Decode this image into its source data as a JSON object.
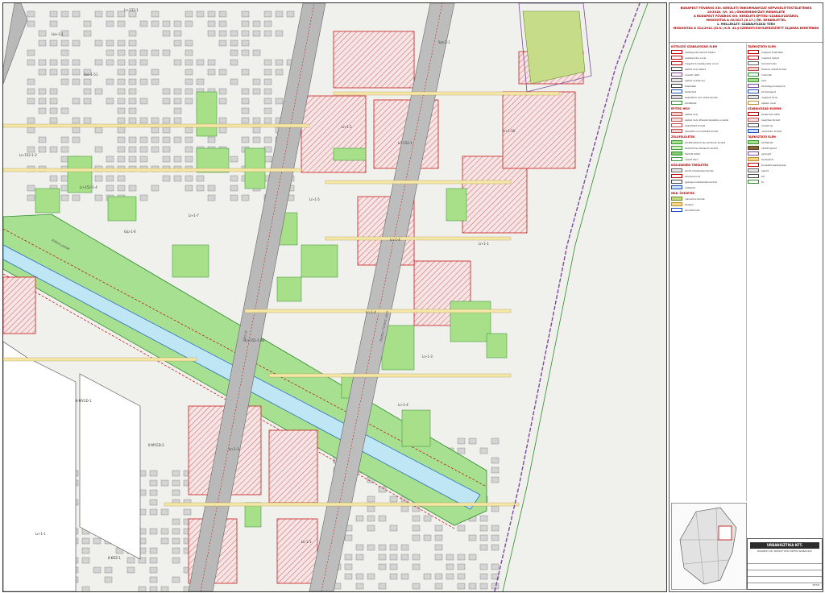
{
  "legend": {
    "titles": [
      "BUDAPEST FŐVÁROS XIII. KERÜLETI ÖNKORMÁNYZAT KÉPVISELŐ-TESTÜLETÉNEK",
      "16/2018. (VI. 15.) ÖNKORMÁNYZATI RENDELETE",
      "A BUDAPEST FŐVÁROS XIII. KERÜLETI ÉPÍTÉSI SZABÁLYZATÁRÓL",
      "MÓDOSÍTVA A 20/2017.(X.17.) ÖR. RENDELETTEL",
      "1. MELLÉKLET: SZABÁLYOZÁSI TERV",
      "MÓDOSÍTÁS A 314/2012.(XI.8.) K.R. 41.§ SZERINTI EGYSZERŰSÍTETT ELJÁRÁS KERETÉBEN"
    ],
    "left_sections": [
      {
        "head": "KÖTELEZŐ SZABÁLYOZÁSI ELEM",
        "rows": [
          {
            "color": "#ffffff",
            "border": "#c00000",
            "text": "szabályozási terület határa"
          },
          {
            "color": "#ffffff",
            "border": "#c00000",
            "text": "szabályozási vonal"
          },
          {
            "color": "#ffffff",
            "border": "#c00000",
            "text": "megszűnő szabályozási vonal"
          },
          {
            "color": "#ffffff",
            "border": "#444444",
            "text": "építési hely határa"
          },
          {
            "color": "#ffffff",
            "border": "#7a4a9a",
            "text": "övezeti határ"
          },
          {
            "color": "#e8e8e8",
            "border": "#666666",
            "text": "építési övezeti jel"
          },
          {
            "color": "#ffffff",
            "border": "#333333",
            "text": "telekhatár"
          },
          {
            "color": "#ffffff",
            "border": "#2050c0",
            "text": "közterület"
          },
          {
            "color": "#dcdcdc",
            "border": "#666666",
            "text": "beépítésre nem szánt terület"
          },
          {
            "color": "#ffffff",
            "border": "#2e8b2e",
            "text": "zöldfelület"
          }
        ]
      },
      {
        "head": "ÉPÍTÉSI HELY",
        "rows": [
          {
            "color": "#f2d4d4",
            "border": "#c05050",
            "text": "építési hely"
          },
          {
            "color": "#f6e0e0",
            "border": "#c05050",
            "text": "építési hely kötelező beépítési vonallal"
          },
          {
            "color": "#ffffff",
            "border": "#c05050",
            "text": "beépíthető terület"
          },
          {
            "color": "#f2d4d4",
            "border": "#c05050",
            "text": "épülettel nem fedhető terület"
          }
        ]
      },
      {
        "head": "ZÖLDFELÜLETEK",
        "rows": [
          {
            "color": "#a8e08a",
            "border": "#3a9a3a",
            "text": "zöldfelületként fenntartandó terület"
          },
          {
            "color": "#d6f0c6",
            "border": "#3a9a3a",
            "text": "kertként fenntartandó terület"
          },
          {
            "color": "#7ccc6a",
            "border": "#3a9a3a",
            "text": "fásított köztér"
          },
          {
            "color": "#ffffff",
            "border": "#3a9a3a",
            "text": "védett fasor"
          }
        ]
      },
      {
        "head": "KÖZLEKEDÉSI TERÜLETEK",
        "rows": [
          {
            "color": "#e6e6e6",
            "border": "#666666",
            "text": "közúti közlekedési terület"
          },
          {
            "color": "#ffffff",
            "border": "#c00000",
            "text": "villamosvonal"
          },
          {
            "color": "#ffffff",
            "border": "#444444",
            "text": "gyalogos közlekedési terület"
          },
          {
            "color": "#cfe3f5",
            "border": "#2050c0",
            "text": "vízfelület"
          }
        ]
      },
      {
        "head": "MKB. ÖVEZETEK",
        "rows": [
          {
            "color": "#c8dc80",
            "border": "#6a8a2a",
            "text": "rekreációs terület"
          },
          {
            "color": "#f5d98a",
            "border": "#c09030",
            "text": "közpark"
          },
          {
            "color": "#ffffff",
            "border": "#2050c0",
            "text": "közműterület"
          }
        ]
      }
    ],
    "right_sections": [
      {
        "head": "TÁJÉKOZTATÓ ELEM",
        "rows": [
          {
            "color": "#ffffff",
            "border": "#c00000",
            "text": "meglévő telekhatár"
          },
          {
            "color": "#ffffff",
            "border": "#c00000",
            "text": "meglévő épület"
          },
          {
            "color": "#ffffff",
            "border": "#666666",
            "text": "kerületi határ"
          },
          {
            "color": "#f2d4d4",
            "border": "#c05050",
            "text": "fővárosi védett terület"
          },
          {
            "color": "#ffffff",
            "border": "#2e8b2e",
            "text": "műemlék"
          },
          {
            "color": "#a8e08a",
            "border": "#3a9a3a",
            "text": "park"
          },
          {
            "color": "#ffffff",
            "border": "#7a4a9a",
            "text": "közösségi kerékpárút"
          },
          {
            "color": "#ffffff",
            "border": "#2050c0",
            "text": "közműalagút"
          },
          {
            "color": "#e6e6e6",
            "border": "#666666",
            "text": "meglévő járda"
          },
          {
            "color": "#ffffff",
            "border": "#c09030",
            "text": "építési vonal"
          }
        ]
      },
      {
        "head": "SZABÁLYOZÁSI ELEMEK",
        "rows": [
          {
            "color": "#ffffff",
            "border": "#c00000",
            "text": "közterületi határ"
          },
          {
            "color": "#f6e0e0",
            "border": "#c05050",
            "text": "beépítési terület"
          },
          {
            "color": "#ffffff",
            "border": "#444444",
            "text": "övezeti jel"
          },
          {
            "color": "#cfe3f5",
            "border": "#2050c0",
            "text": "vízvédelmi terület"
          }
        ]
      },
      {
        "head": "TÁJÉKOZTATÓ ELEM",
        "rows": [
          {
            "color": "#a8e08a",
            "border": "#3a9a3a",
            "text": "zöldfelület"
          },
          {
            "color": "#8a6a3a",
            "border": "#5a4020",
            "text": "védett épület"
          },
          {
            "color": "#ffffff",
            "border": "#7a4a9a",
            "text": "gyalogút"
          },
          {
            "color": "#f5d98a",
            "border": "#c09030",
            "text": "kerékpárút"
          },
          {
            "color": "#ffffff",
            "border": "#c00000",
            "text": "tervezett szabályozás"
          },
          {
            "color": "#e6e6e6",
            "border": "#666666",
            "text": "épület"
          },
          {
            "color": "#ffffff",
            "border": "#444444",
            "text": "kút"
          },
          {
            "color": "#ffffff",
            "border": "#2e8b2e",
            "text": "fa"
          }
        ]
      }
    ],
    "company": "URBANISZTIKA KFT.",
    "company_sub": "BUDAPEST XIII. KERÜLET HELYI ÉPÍTÉSI SZABÁLYZAT",
    "sheet_code": "SZT-8"
  }
}
